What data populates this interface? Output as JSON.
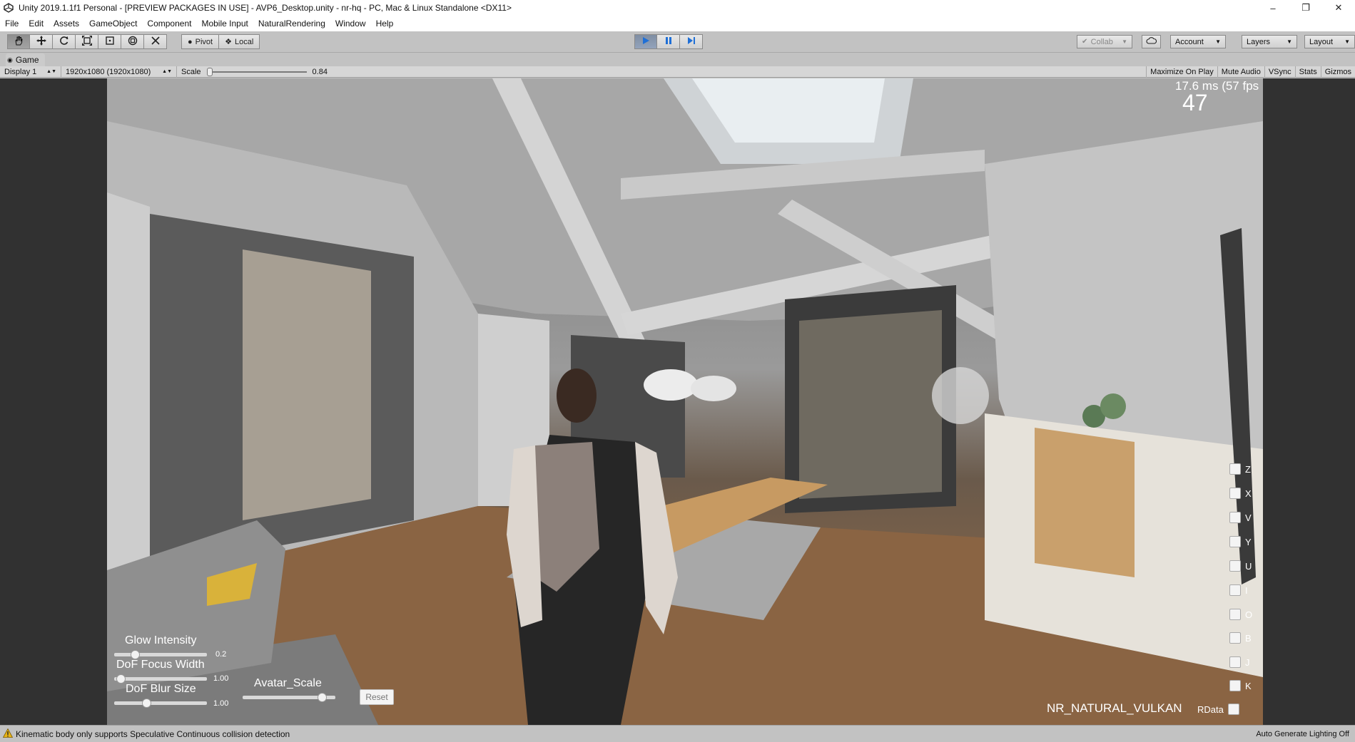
{
  "window": {
    "title": "Unity 2019.1.1f1 Personal - [PREVIEW PACKAGES IN USE] - AVP6_Desktop.unity - nr-hq - PC, Mac & Linux Standalone <DX11>",
    "minimize": "–",
    "maximize": "❐",
    "close": "✕"
  },
  "menu": [
    "File",
    "Edit",
    "Assets",
    "GameObject",
    "Component",
    "Mobile Input",
    "NaturalRendering",
    "Window",
    "Help"
  ],
  "toolbar": {
    "tools": [
      "hand-icon",
      "move-icon",
      "rotate-icon",
      "scale-icon",
      "rect-icon",
      "transform-icon",
      "custom-tool-icon"
    ],
    "pivot_label": "Pivot",
    "local_label": "Local",
    "collab_label": "Collab",
    "account_label": "Account",
    "layers_label": "Layers",
    "layout_label": "Layout"
  },
  "game_tab": {
    "label": "Game"
  },
  "game_bar": {
    "display": "Display 1",
    "resolution": "1920x1080 (1920x1080)",
    "scale_label": "Scale",
    "scale_value": "0.84",
    "maximize_on_play": "Maximize On Play",
    "mute_audio": "Mute Audio",
    "vsync": "VSync",
    "stats": "Stats",
    "gizmos": "Gizmos"
  },
  "overlay": {
    "fps_ms": "17.6 ms (57 fps",
    "fps_big": "47",
    "sliders": {
      "glow_label": "Glow Intensity",
      "glow_value": "0.2",
      "glow_level": 0.2,
      "dof_focus_label": "DoF Focus Width",
      "dof_focus_value": "1.00",
      "dof_blur_label": "DoF Blur Size",
      "dof_blur_value": "1.00",
      "avatar_label": "Avatar_Scale"
    },
    "reset_label": "Reset",
    "toggles": [
      "Z",
      "X",
      "V",
      "Y",
      "U",
      "I",
      "O",
      "B",
      "J",
      "K"
    ],
    "profile_label": "NR_NATURAL_VULKAN",
    "rdata_label": "RData"
  },
  "status": {
    "message": "Kinematic body only supports Speculative Continuous collision detection",
    "right": "Auto Generate Lighting Off"
  }
}
